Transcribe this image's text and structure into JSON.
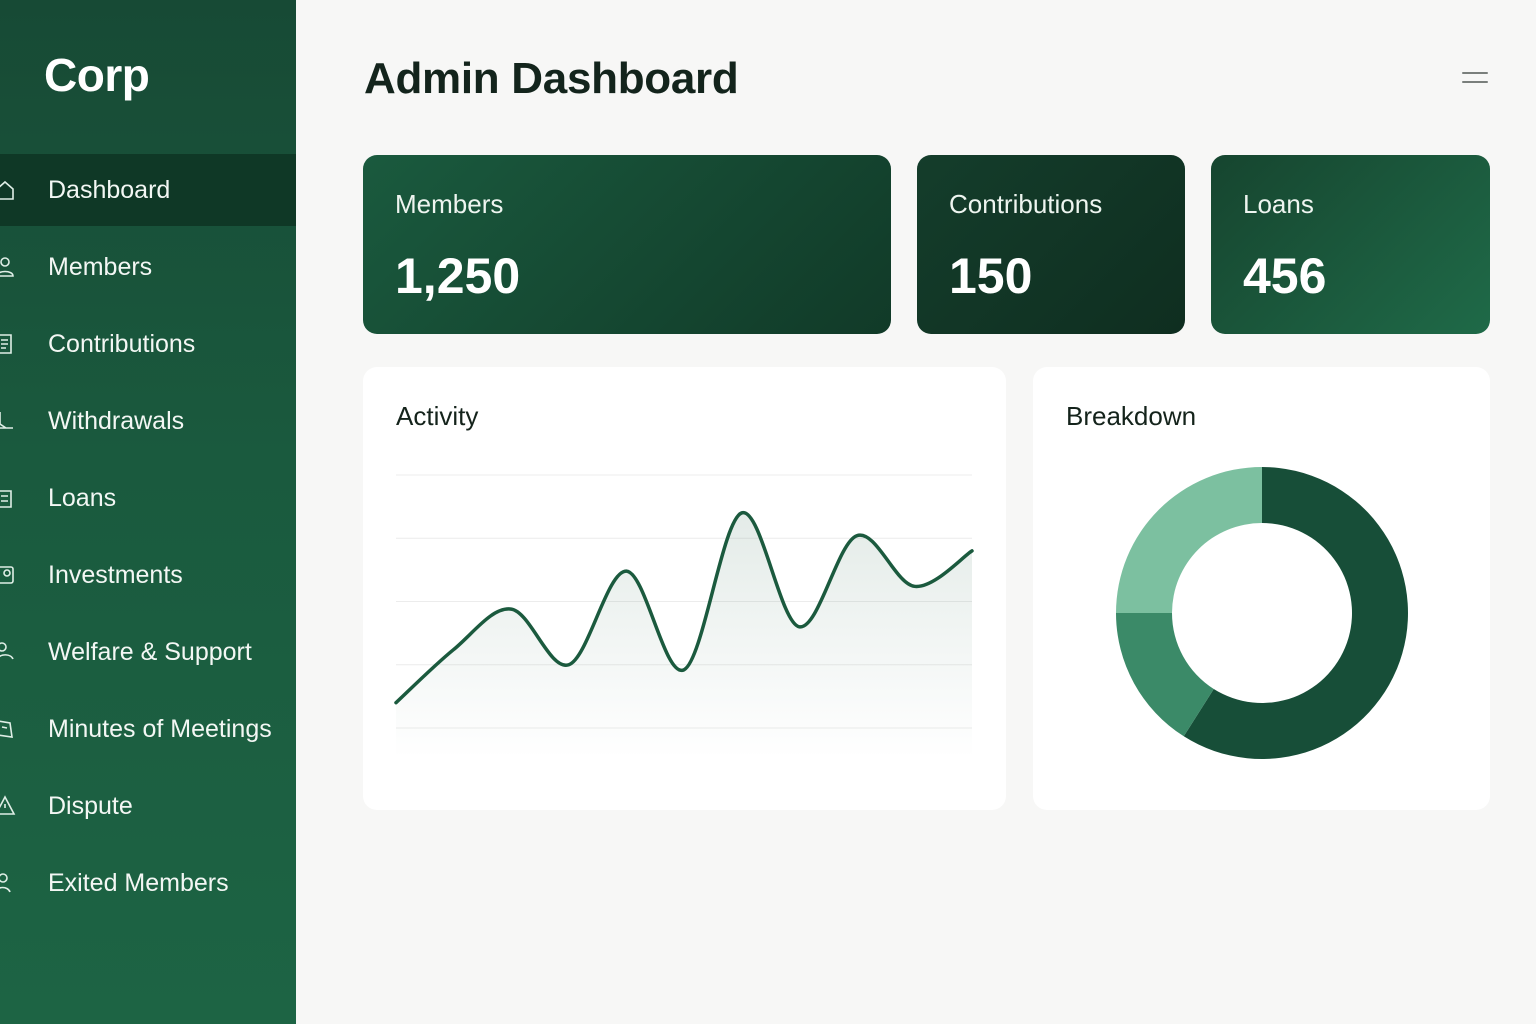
{
  "brand": "Corp",
  "page_title": "Admin Dashboard",
  "sidebar": {
    "active_index": 0,
    "items": [
      {
        "label": "Dashboard",
        "icon": "home-icon"
      },
      {
        "label": "Members",
        "icon": "user-icon"
      },
      {
        "label": "Contributions",
        "icon": "document-icon"
      },
      {
        "label": "Withdrawals",
        "icon": "withdraw-icon"
      },
      {
        "label": "Loans",
        "icon": "loan-icon"
      },
      {
        "label": "Investments",
        "icon": "investment-icon"
      },
      {
        "label": "Welfare & Support",
        "icon": "welfare-icon"
      },
      {
        "label": "Minutes of Meetings",
        "icon": "meetings-icon"
      },
      {
        "label": "Dispute",
        "icon": "warning-icon"
      },
      {
        "label": "Exited Members",
        "icon": "exited-user-icon"
      }
    ]
  },
  "header": {
    "menu_icon": "menu-icon"
  },
  "stats": {
    "members": {
      "label": "Members",
      "value": "1,250"
    },
    "contributions": {
      "label": "Contributions",
      "value": "150"
    },
    "loans": {
      "label": "Loans",
      "value": "456"
    }
  },
  "activity": {
    "title": "Activity"
  },
  "breakdown": {
    "title": "Breakdown"
  },
  "colors": {
    "sidebar": "#1a5a3e",
    "active": "#0f3826",
    "line": "#1b5a3e",
    "donut": [
      "#174e38",
      "#3b8a68",
      "#7cc0a0"
    ]
  },
  "chart_data": [
    {
      "type": "area",
      "title": "Activity",
      "x": [
        0,
        1,
        2,
        3,
        4,
        5,
        6,
        7,
        8,
        9,
        10
      ],
      "series": [
        {
          "values": [
            10,
            31,
            47,
            25,
            62,
            23,
            85,
            40,
            76,
            56,
            70
          ]
        }
      ],
      "ylim": [
        0,
        100
      ],
      "grid": true
    },
    {
      "type": "pie",
      "title": "Breakdown",
      "values": [
        59,
        16,
        25
      ],
      "donut": true
    }
  ]
}
